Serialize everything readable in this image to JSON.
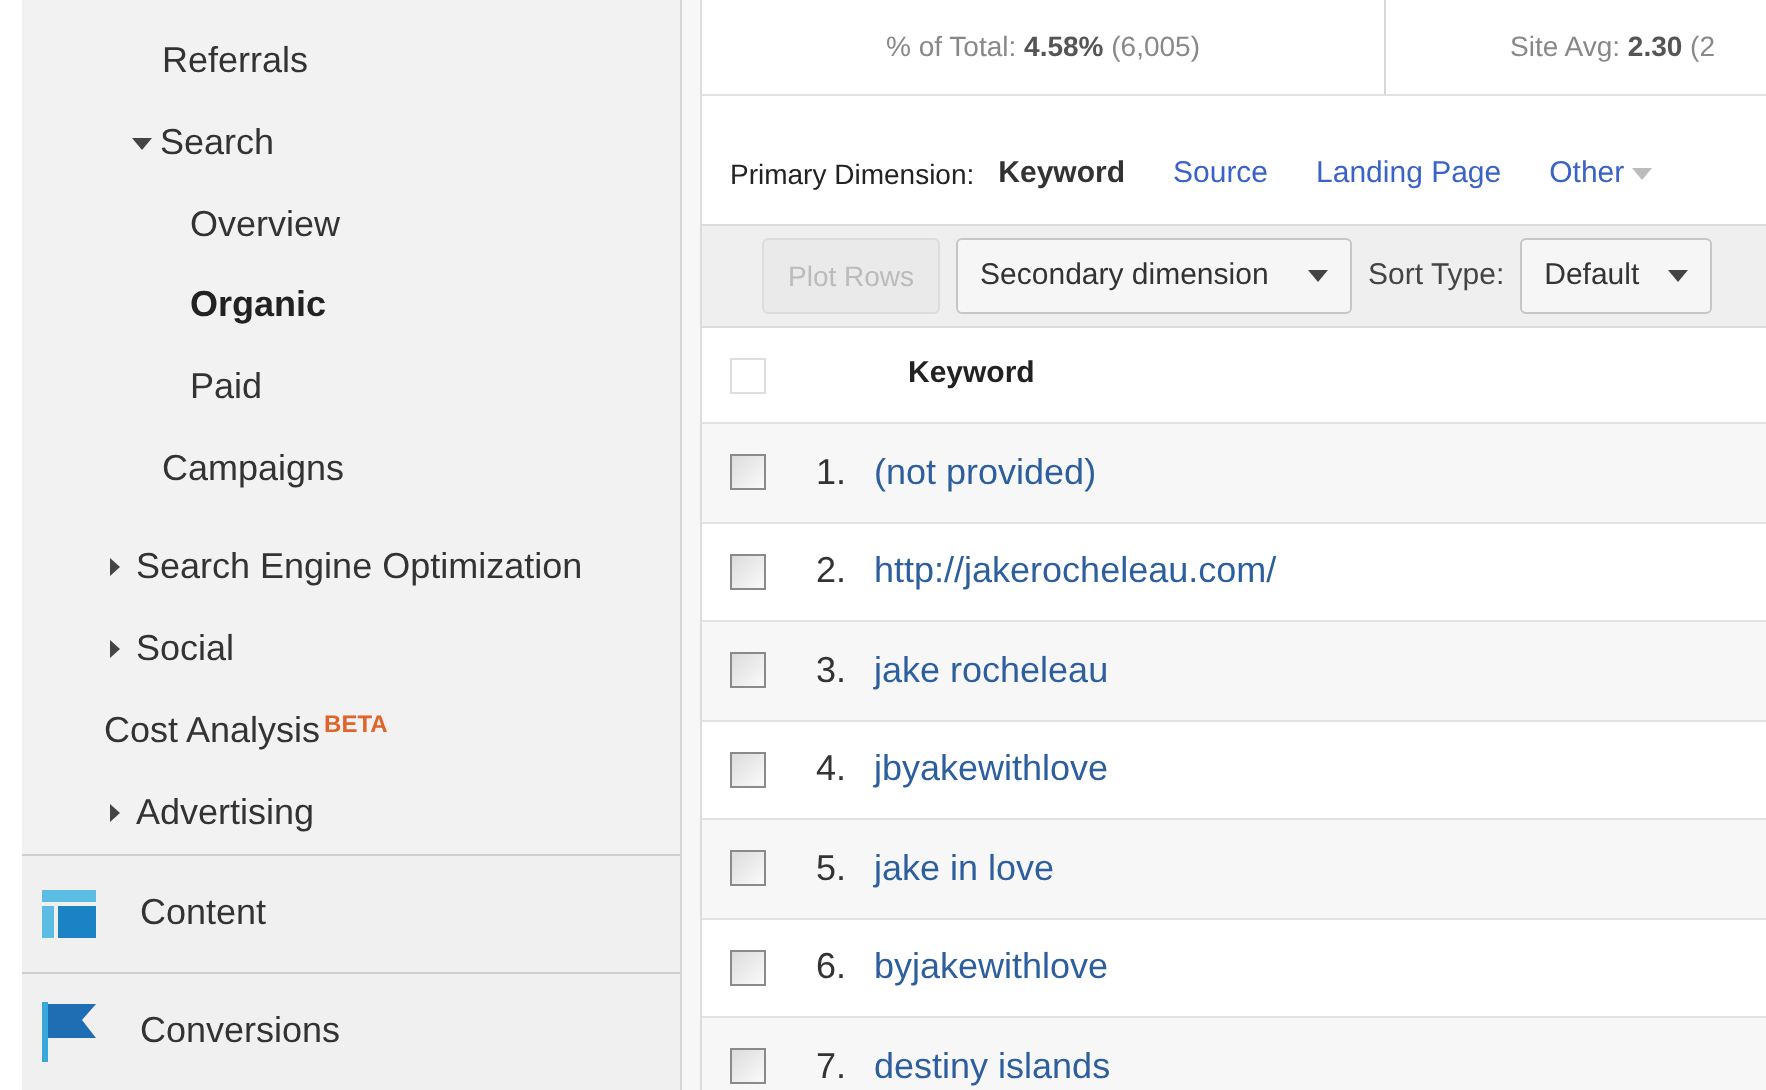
{
  "sidebar": {
    "items": [
      {
        "label": "Referrals",
        "kind": "sub"
      },
      {
        "label": "Search",
        "kind": "sub",
        "expanded": true,
        "children": [
          {
            "label": "Overview",
            "selected": false
          },
          {
            "label": "Organic",
            "selected": true
          },
          {
            "label": "Paid",
            "selected": false
          }
        ]
      },
      {
        "label": "Campaigns",
        "kind": "sub"
      },
      {
        "label": "Search Engine Optimization",
        "kind": "top",
        "expanded": false
      },
      {
        "label": "Social",
        "kind": "top",
        "expanded": false
      },
      {
        "label": "Cost Analysis",
        "kind": "top",
        "badge": "BETA"
      },
      {
        "label": "Advertising",
        "kind": "top",
        "expanded": false
      }
    ],
    "sections": [
      {
        "label": "Content",
        "kind": "content"
      },
      {
        "label": "Conversions",
        "kind": "conversions"
      }
    ]
  },
  "summary": [
    {
      "text": "% of Total: **4.58%** (6,005)"
    },
    {
      "text": "Site Avg: **2.30** (2"
    }
  ],
  "primary_dimension": {
    "label": "Primary Dimension:",
    "options": [
      {
        "label": "Keyword",
        "selected": true
      },
      {
        "label": "Source",
        "selected": false
      },
      {
        "label": "Landing Page",
        "selected": false
      },
      {
        "label": "Other",
        "selected": false,
        "dropdown": true
      }
    ]
  },
  "toolbar": {
    "plot_rows": {
      "label": "Plot Rows",
      "disabled": true
    },
    "secondary_dimension": "Secondary dimension",
    "sort_label": "Sort Type:",
    "sort_value": "Default"
  },
  "table": {
    "columns": [
      "Keyword"
    ],
    "select_all_checked": false,
    "rows": [
      {
        "index": "1.",
        "keyword": "(not provided)",
        "checked": false
      },
      {
        "index": "2.",
        "keyword": "http://jakerocheleau.com/",
        "checked": false
      },
      {
        "index": "3.",
        "keyword": "jake rocheleau",
        "checked": false
      },
      {
        "index": "4.",
        "keyword": "jbyakewithlove",
        "checked": false
      },
      {
        "index": "5.",
        "keyword": "jake in love",
        "checked": false
      },
      {
        "index": "6.",
        "keyword": "byjakewithlove",
        "checked": false
      },
      {
        "index": "7.",
        "keyword": "destiny islands",
        "checked": false
      }
    ]
  }
}
